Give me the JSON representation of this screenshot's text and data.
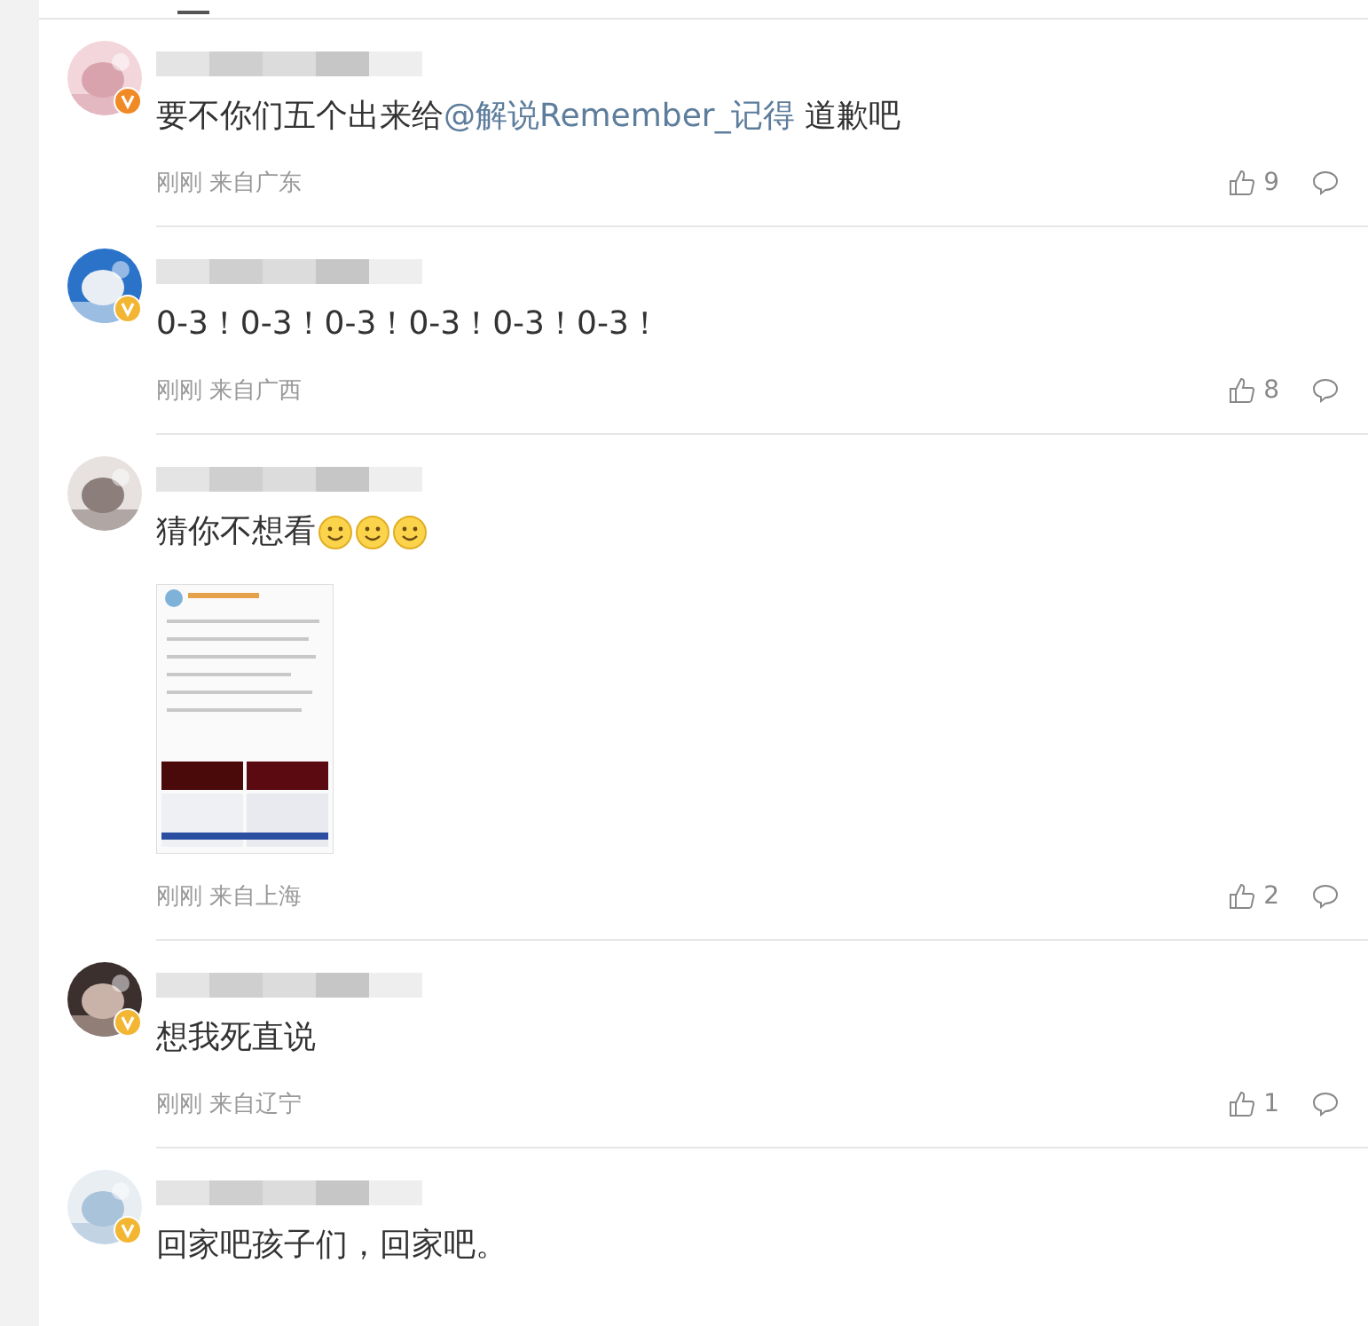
{
  "comments": [
    {
      "verified": true,
      "color": "#f08a24",
      "parts": [
        {
          "kind": "text",
          "text": "要不你们五个出来给"
        },
        {
          "kind": "mention",
          "text": "@解说Remember_记得"
        },
        {
          "kind": "text",
          "text": " 道歉吧"
        }
      ],
      "meta": "刚刚 来自广东",
      "likes": "9"
    },
    {
      "verified": true,
      "color": "#f2b632",
      "parts": [
        {
          "kind": "text",
          "text": "0-3！0-3！0-3！0-3！0-3！0-3！"
        }
      ],
      "meta": "刚刚 来自广西",
      "likes": "8"
    },
    {
      "verified": false,
      "parts": [
        {
          "kind": "text",
          "text": "猜你不想看"
        },
        {
          "kind": "emoji"
        },
        {
          "kind": "emoji"
        },
        {
          "kind": "emoji"
        }
      ],
      "image": {
        "kind": "picture"
      },
      "meta": "刚刚 来自上海",
      "likes": "2"
    },
    {
      "verified": true,
      "color": "#f2b632",
      "parts": [
        {
          "kind": "text",
          "text": "想我死直说"
        }
      ],
      "meta": "刚刚 来自辽宁",
      "likes": "1"
    },
    {
      "verified": true,
      "color": "#f2b632",
      "parts": [
        {
          "kind": "text",
          "text": "回家吧孩子们，回家吧。"
        }
      ]
    }
  ]
}
